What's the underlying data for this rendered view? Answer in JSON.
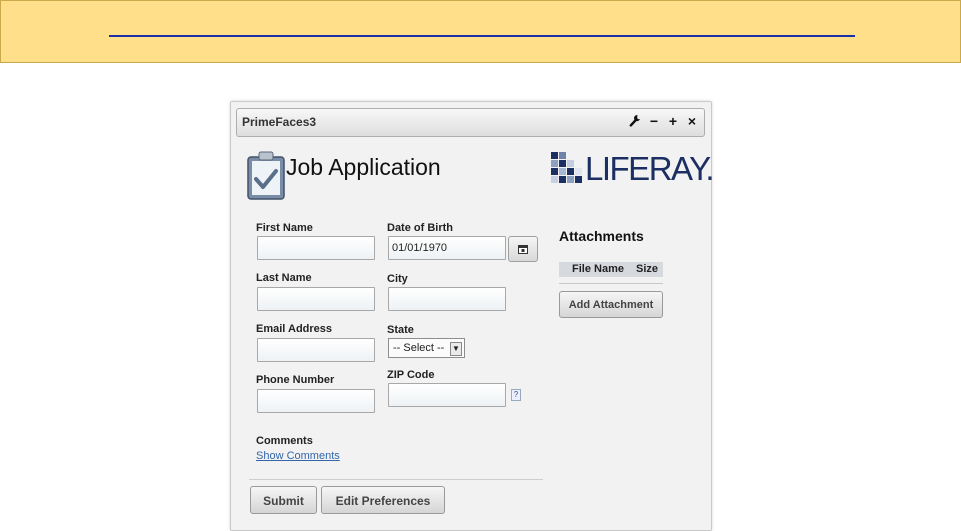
{
  "portlet": {
    "title": "PrimeFaces3",
    "icons": [
      "wrench-icon",
      "minimize-icon",
      "maximize-icon",
      "close-icon"
    ],
    "minus_glyph": "−",
    "plus_glyph": "+",
    "close_glyph": "×"
  },
  "header": {
    "heading": "Job Application",
    "logo_text": "LIFERAY."
  },
  "form": {
    "first_name_label": "First Name",
    "last_name_label": "Last Name",
    "email_label": "Email Address",
    "phone_label": "Phone Number",
    "dob_label": "Date of Birth",
    "dob_value": "01/01/1970",
    "city_label": "City",
    "state_label": "State",
    "state_selected": "-- Select --",
    "zip_label": "ZIP Code",
    "comments_label": "Comments",
    "show_comments_link": "Show Comments",
    "help_glyph": "?"
  },
  "attachments": {
    "title": "Attachments",
    "col_file_name": "File Name",
    "col_size": "Size",
    "add_button": "Add Attachment"
  },
  "buttons": {
    "submit": "Submit",
    "edit_preferences": "Edit Preferences"
  },
  "colors": {
    "banner": "#ffdf8a",
    "banner_link": "#1a2fa8",
    "logo": "#1b2f63",
    "link": "#3366aa"
  }
}
